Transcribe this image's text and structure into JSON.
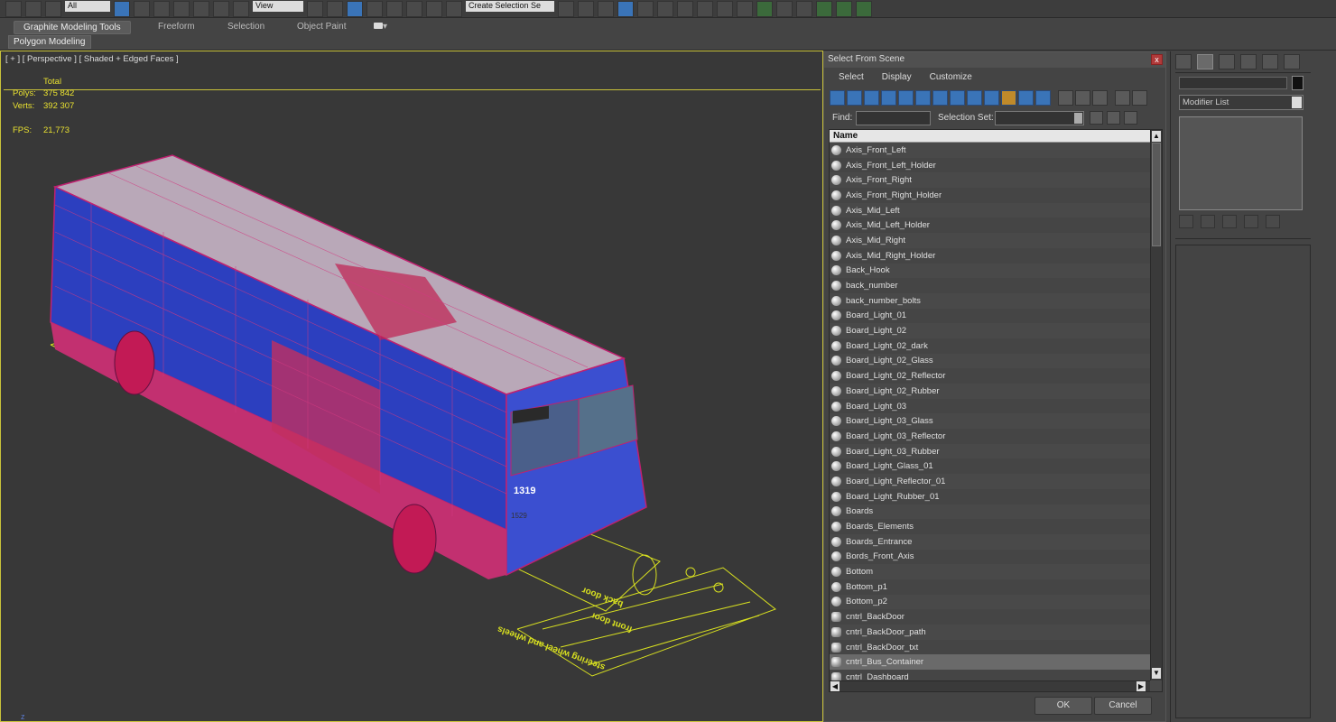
{
  "toolbar": {
    "filter_value": "All",
    "ref_coord_value": "View",
    "selection_set_placeholder": "Create Selection Se"
  },
  "ribbon": {
    "tabs": [
      "Graphite Modeling Tools",
      "Freeform",
      "Selection",
      "Object Paint"
    ],
    "active_tab": "Graphite Modeling Tools",
    "panel_label": "Polygon Modeling"
  },
  "viewport": {
    "label": "[ + ] [ Perspective ] [ Shaded + Edged Faces ]",
    "stats": {
      "total_header": "Total",
      "polys_label": "Polys:",
      "polys_value": "375 842",
      "verts_label": "Verts:",
      "verts_value": "392 307",
      "fps_label": "FPS:",
      "fps_value": "21,773"
    },
    "annotations": [
      "back door",
      "front door",
      "steering wheel and wheels"
    ],
    "bus_number": "1319",
    "bus_plate": "1529",
    "axis_label": "z"
  },
  "dialog": {
    "title": "Select From Scene",
    "close_label": "x",
    "menu": [
      "Select",
      "Display",
      "Customize"
    ],
    "find_label": "Find:",
    "find_value": "",
    "selection_set_label": "Selection Set:",
    "column_header": "Name",
    "selected_item": "cntrl_Bus_Container",
    "items": [
      {
        "name": "Axis_Front_Left",
        "type": "object"
      },
      {
        "name": "Axis_Front_Left_Holder",
        "type": "object"
      },
      {
        "name": "Axis_Front_Right",
        "type": "object"
      },
      {
        "name": "Axis_Front_Right_Holder",
        "type": "object"
      },
      {
        "name": "Axis_Mid_Left",
        "type": "object"
      },
      {
        "name": "Axis_Mid_Left_Holder",
        "type": "object"
      },
      {
        "name": "Axis_Mid_Right",
        "type": "object"
      },
      {
        "name": "Axis_Mid_Right_Holder",
        "type": "object"
      },
      {
        "name": "Back_Hook",
        "type": "object"
      },
      {
        "name": "back_number",
        "type": "object"
      },
      {
        "name": "back_number_bolts",
        "type": "object"
      },
      {
        "name": "Board_Light_01",
        "type": "object"
      },
      {
        "name": "Board_Light_02",
        "type": "object"
      },
      {
        "name": "Board_Light_02_dark",
        "type": "object"
      },
      {
        "name": "Board_Light_02_Glass",
        "type": "object"
      },
      {
        "name": "Board_Light_02_Reflector",
        "type": "object"
      },
      {
        "name": "Board_Light_02_Rubber",
        "type": "object"
      },
      {
        "name": "Board_Light_03",
        "type": "object"
      },
      {
        "name": "Board_Light_03_Glass",
        "type": "object"
      },
      {
        "name": "Board_Light_03_Reflector",
        "type": "object"
      },
      {
        "name": "Board_Light_03_Rubber",
        "type": "object"
      },
      {
        "name": "Board_Light_Glass_01",
        "type": "object"
      },
      {
        "name": "Board_Light_Reflector_01",
        "type": "object"
      },
      {
        "name": "Board_Light_Rubber_01",
        "type": "object"
      },
      {
        "name": "Boards",
        "type": "object"
      },
      {
        "name": "Boards_Elements",
        "type": "object"
      },
      {
        "name": "Boards_Entrance",
        "type": "object"
      },
      {
        "name": "Bords_Front_Axis",
        "type": "object"
      },
      {
        "name": "Bottom",
        "type": "object"
      },
      {
        "name": "Bottom_p1",
        "type": "object"
      },
      {
        "name": "Bottom_p2",
        "type": "object"
      },
      {
        "name": "cntrl_BackDoor",
        "type": "helper"
      },
      {
        "name": "cntrl_BackDoor_path",
        "type": "helper"
      },
      {
        "name": "cntrl_BackDoor_txt",
        "type": "helper"
      },
      {
        "name": "cntrl_Bus_Container",
        "type": "helper"
      },
      {
        "name": "cntrl_Dashboard",
        "type": "helper"
      }
    ],
    "ok_label": "OK",
    "cancel_label": "Cancel"
  },
  "command_panel": {
    "modifier_list_label": "Modifier List"
  },
  "colors": {
    "viewport_border": "#c9c23a",
    "stats_text": "#e8e030",
    "wire_blue": "#2a3fd0",
    "wire_magenta": "#d0206a",
    "helper_yellow": "#d8e020"
  }
}
